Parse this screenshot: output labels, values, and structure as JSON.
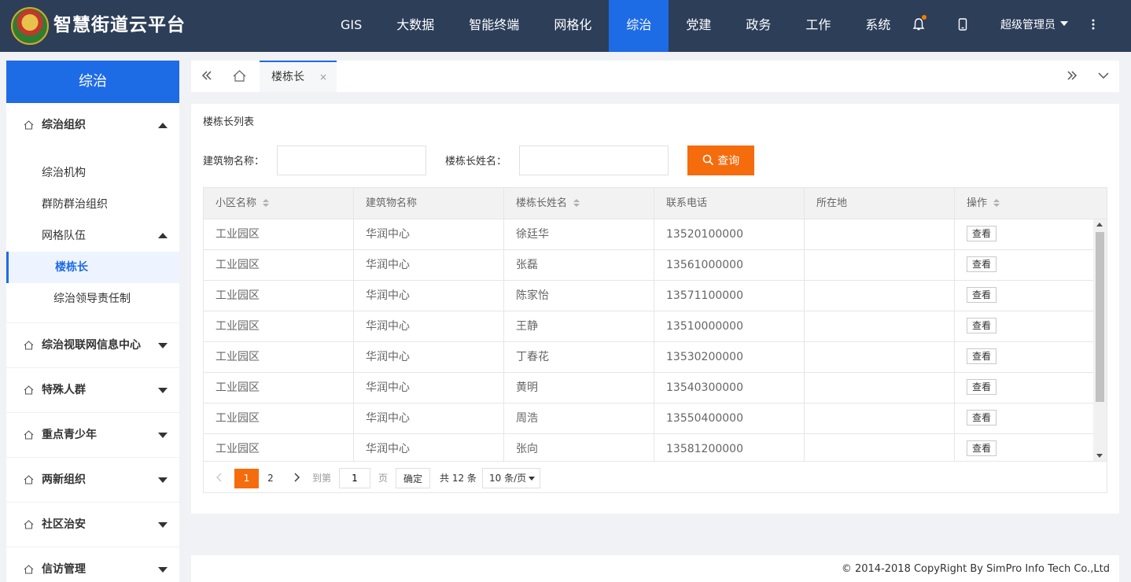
{
  "app": {
    "title": "智慧街道云平台"
  },
  "nav": {
    "items": [
      "GIS",
      "大数据",
      "智能终端",
      "网格化",
      "综治",
      "党建",
      "政务",
      "工作",
      "系统"
    ],
    "active_index": 4,
    "user": "超级管理员",
    "icons": [
      "bell-icon",
      "tablet-icon",
      "more-vertical-icon"
    ]
  },
  "sidebar": {
    "header": "综治",
    "groups": [
      {
        "label": "综治组织",
        "expanded": true
      },
      {
        "label": "综治视联网信息中心",
        "expanded": false
      },
      {
        "label": "特殊人群",
        "expanded": false
      },
      {
        "label": "重点青少年",
        "expanded": false
      },
      {
        "label": "两新组织",
        "expanded": false
      },
      {
        "label": "社区治安",
        "expanded": false
      },
      {
        "label": "信访管理",
        "expanded": false
      }
    ],
    "sub": [
      "综治机构",
      "群防群治组织",
      "网格队伍"
    ],
    "sub2": [
      "楼栋长",
      "综治领导责任制"
    ]
  },
  "tabs": {
    "active": "楼栋长",
    "close": "×"
  },
  "panel": {
    "title": "楼栋长列表",
    "filters": {
      "building_label": "建筑物名称：",
      "name_label": "楼栋长姓名：",
      "building_value": "",
      "name_value": ""
    },
    "query_button": "查询"
  },
  "table": {
    "columns": [
      "小区名称",
      "建筑物名称",
      "楼栋长姓名",
      "联系电话",
      "所在地",
      "操作"
    ],
    "rows": [
      [
        "工业园区",
        "华润中心",
        "徐廷华",
        "13520100000",
        "",
        "查看"
      ],
      [
        "工业园区",
        "华润中心",
        "张磊",
        "13561000000",
        "",
        "查看"
      ],
      [
        "工业园区",
        "华润中心",
        "陈家怡",
        "13571100000",
        "",
        "查看"
      ],
      [
        "工业园区",
        "华润中心",
        "王静",
        "13510000000",
        "",
        "查看"
      ],
      [
        "工业园区",
        "华润中心",
        "丁春花",
        "13530200000",
        "",
        "查看"
      ],
      [
        "工业园区",
        "华润中心",
        "黄明",
        "13540300000",
        "",
        "查看"
      ],
      [
        "工业园区",
        "华润中心",
        "周浩",
        "13550400000",
        "",
        "查看"
      ],
      [
        "工业园区",
        "华润中心",
        "张向",
        "13581200000",
        "",
        "查看"
      ]
    ]
  },
  "pager": {
    "pages": [
      "1",
      "2"
    ],
    "current": "1",
    "goto_label": "到第",
    "goto_value": "1",
    "page_unit": "页",
    "confirm": "确定",
    "total": "共 12 条",
    "page_size": "10 条/页"
  },
  "footer": {
    "copyright": "© 2014-2018 CopyRight By SimPro Info Tech Co.,Ltd"
  },
  "colors": {
    "header_bg": "#2d3e59",
    "accent": "#1e6be6",
    "query": "#f56c0c"
  }
}
